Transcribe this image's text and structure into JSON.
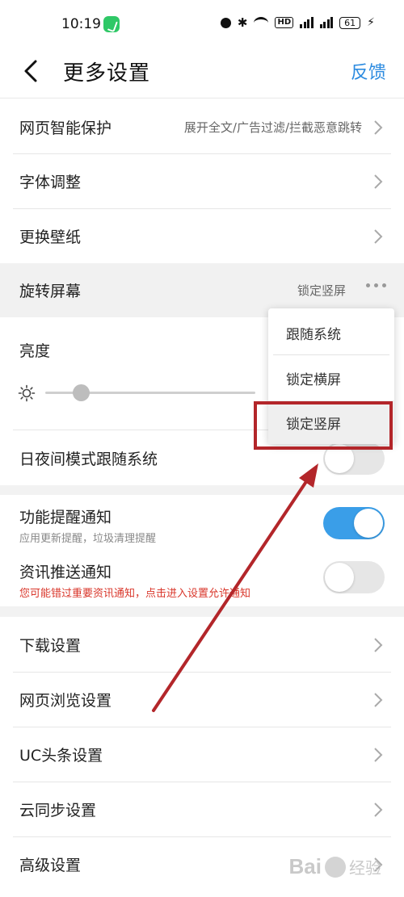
{
  "status_bar": {
    "time": "10:19",
    "battery": "61"
  },
  "header": {
    "title": "更多设置",
    "feedback": "反馈"
  },
  "settings": {
    "web_protection": {
      "label": "网页智能保护",
      "value": "展开全文/广告过滤/拦截恶意跳转"
    },
    "font_adjust": {
      "label": "字体调整"
    },
    "wallpaper": {
      "label": "更换壁纸"
    },
    "rotate_screen": {
      "label": "旋转屏幕",
      "value": "锁定竖屏"
    },
    "brightness": {
      "label": "亮度",
      "level": 0.17
    },
    "night_mode": {
      "label": "日夜间模式跟随系统",
      "enabled": false
    },
    "feature_notice": {
      "label": "功能提醒通知",
      "sub": "应用更新提醒，垃圾清理提醒",
      "enabled": true
    },
    "news_push": {
      "label": "资讯推送通知",
      "warning": "您可能错过重要资讯通知，点击进入设置允许通知",
      "enabled": false
    },
    "download": {
      "label": "下载设置"
    },
    "web_browsing": {
      "label": "网页浏览设置"
    },
    "uc_headlines": {
      "label": "UC头条设置"
    },
    "cloud_sync": {
      "label": "云同步设置"
    },
    "advanced": {
      "label": "高级设置"
    }
  },
  "rotate_menu": {
    "options": [
      "跟随系统",
      "锁定横屏",
      "锁定竖屏"
    ],
    "selected": "锁定竖屏"
  },
  "watermark": {
    "logo": "Bai",
    "text": "经验"
  },
  "colors": {
    "accent": "#3a9ee8",
    "link": "#2c8be0",
    "warning": "#d9362a",
    "annotation": "#b3262a"
  },
  "icons": [
    "back-icon",
    "chevron-right-icon",
    "more-dots-icon",
    "sun-icon",
    "alarm-icon",
    "bluetooth-icon",
    "wifi-icon",
    "signal-icon",
    "battery-icon"
  ]
}
